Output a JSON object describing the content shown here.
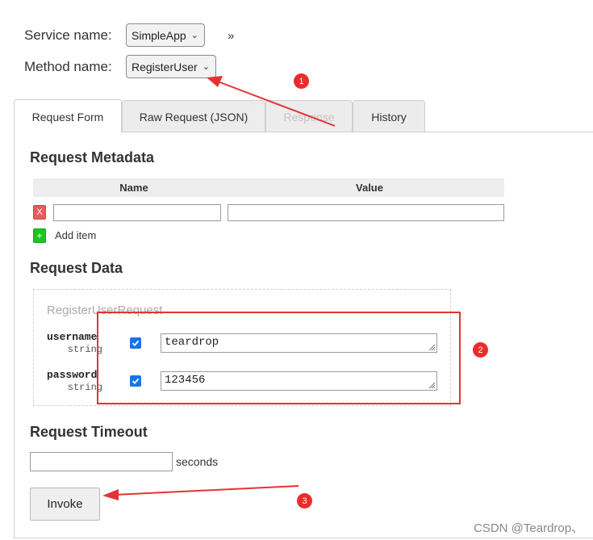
{
  "service": {
    "label": "Service name:",
    "value": "SimpleApp"
  },
  "method": {
    "label": "Method name:",
    "value": "RegisterUser"
  },
  "collapse_glyph": "»",
  "tabs": [
    {
      "label": "Request Form",
      "state": "active"
    },
    {
      "label": "Raw Request (JSON)",
      "state": "normal"
    },
    {
      "label": "Response",
      "state": "disabled"
    },
    {
      "label": "History",
      "state": "normal"
    }
  ],
  "metadata": {
    "heading": "Request Metadata",
    "columns": [
      "Name",
      "Value"
    ],
    "rows": [
      {
        "name": "",
        "value": ""
      }
    ],
    "remove_label": "X",
    "add_icon": "+",
    "add_label": "Add item"
  },
  "request_data": {
    "heading": "Request Data",
    "message_type": "RegisterUserRequest",
    "fields": [
      {
        "name": "username",
        "type": "string",
        "checked": true,
        "value": "teardrop"
      },
      {
        "name": "password",
        "type": "string",
        "checked": true,
        "value": "123456"
      }
    ]
  },
  "timeout": {
    "heading": "Request Timeout",
    "value": "",
    "unit": "seconds"
  },
  "invoke_label": "Invoke",
  "annotations": [
    "1",
    "2",
    "3"
  ],
  "watermark": "CSDN @Teardrop、",
  "colors": {
    "annotation_red": "#e53333",
    "checkbox_blue": "#1b73e8",
    "add_green": "#21c321",
    "remove_red": "#e75c5c"
  }
}
